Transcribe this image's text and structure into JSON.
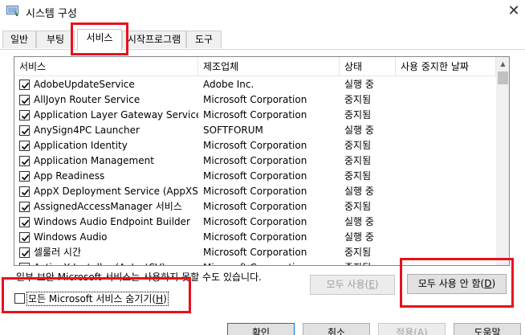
{
  "window": {
    "title": "시스템 구성",
    "close_glyph": "✕"
  },
  "tabs": [
    {
      "label": "일반",
      "active": false
    },
    {
      "label": "부팅",
      "active": false
    },
    {
      "label": "서비스",
      "active": true
    },
    {
      "label": "시작프로그램",
      "active": false
    },
    {
      "label": "도구",
      "active": false
    }
  ],
  "services": {
    "columns": [
      "서비스",
      "제조업체",
      "상태",
      "사용 중지한 날짜"
    ],
    "rows": [
      {
        "name": "AdobeUpdateService",
        "vendor": "Adobe Inc.",
        "status": "실행 중",
        "checked": true
      },
      {
        "name": "AllJoyn Router Service",
        "vendor": "Microsoft Corporation",
        "status": "중지됨",
        "checked": true
      },
      {
        "name": "Application Layer Gateway Service",
        "vendor": "Microsoft Corporation",
        "status": "중지됨",
        "checked": true
      },
      {
        "name": "AnySign4PC Launcher",
        "vendor": "SOFTFORUM",
        "status": "실행 중",
        "checked": true
      },
      {
        "name": "Application Identity",
        "vendor": "Microsoft Corporation",
        "status": "중지됨",
        "checked": true
      },
      {
        "name": "Application Management",
        "vendor": "Microsoft Corporation",
        "status": "중지됨",
        "checked": true
      },
      {
        "name": "App Readiness",
        "vendor": "Microsoft Corporation",
        "status": "중지됨",
        "checked": true
      },
      {
        "name": "AppX Deployment Service (AppXSV...",
        "vendor": "Microsoft Corporation",
        "status": "실행 중",
        "checked": true
      },
      {
        "name": "AssignedAccessManager 서비스",
        "vendor": "Microsoft Corporation",
        "status": "중지됨",
        "checked": true
      },
      {
        "name": "Windows Audio Endpoint Builder",
        "vendor": "Microsoft Corporation",
        "status": "실행 중",
        "checked": true
      },
      {
        "name": "Windows Audio",
        "vendor": "Microsoft Corporation",
        "status": "실행 중",
        "checked": true
      },
      {
        "name": "셀룰러 시간",
        "vendor": "Microsoft Corporation",
        "status": "중지됨",
        "checked": true
      },
      {
        "name": "ActiveX Installer (AxInstSV)",
        "vendor": "Microsoft Corporation",
        "status": "중지됨",
        "checked": true
      }
    ]
  },
  "note": "일부 보안 Microsoft 서비스는 사용하지 못할 수도 있습니다.",
  "buttons": {
    "enable_all": "모두 사용(E)",
    "disable_all": "모두 사용 안 함(D)",
    "ok": "확인",
    "cancel": "취소",
    "apply": "적용(A)",
    "help": "도움말"
  },
  "hide_ms": {
    "label": "모든 Microsoft 서비스 숨기기(H)",
    "checked": false
  },
  "colors": {
    "highlight": "#e8101c",
    "check": "#000000"
  }
}
